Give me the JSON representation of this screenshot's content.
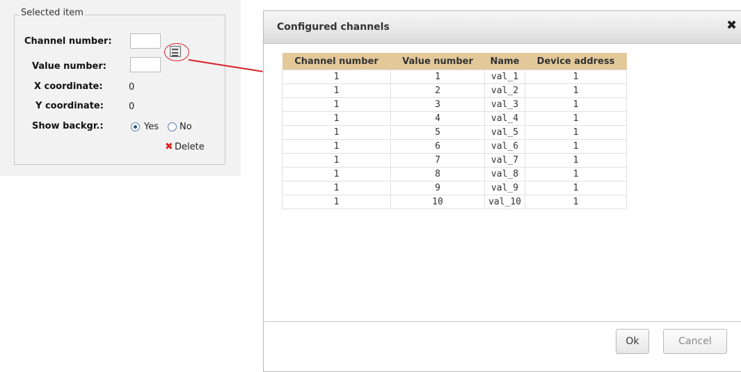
{
  "selected_item": {
    "legend": "Selected item",
    "channel_number_label": "Channel number:",
    "channel_number_value": "",
    "value_number_label": "Value number:",
    "value_number_value": "",
    "x_coordinate_label": "X coordinate:",
    "x_coordinate_value": "0",
    "y_coordinate_label": "Y coordinate:",
    "y_coordinate_value": "0",
    "show_background_label": "Show backgr.:",
    "radio_yes_label": "Yes",
    "radio_no_label": "No",
    "show_background_selected": "Yes",
    "delete_label": "Delete",
    "list_icon": "list-icon"
  },
  "annotation": {
    "color": "#d8202a"
  },
  "dialog": {
    "title": "Configured channels",
    "close_icon": "close-icon",
    "columns": [
      "Channel number",
      "Value number",
      "Name",
      "Device address"
    ],
    "rows": [
      [
        "1",
        "1",
        "val_1",
        "1"
      ],
      [
        "1",
        "2",
        "val_2",
        "1"
      ],
      [
        "1",
        "3",
        "val_3",
        "1"
      ],
      [
        "1",
        "4",
        "val_4",
        "1"
      ],
      [
        "1",
        "5",
        "val_5",
        "1"
      ],
      [
        "1",
        "6",
        "val_6",
        "1"
      ],
      [
        "1",
        "7",
        "val_7",
        "1"
      ],
      [
        "1",
        "8",
        "val_8",
        "1"
      ],
      [
        "1",
        "9",
        "val_9",
        "1"
      ],
      [
        "1",
        "10",
        "val_10",
        "1"
      ]
    ],
    "ok_label": "Ok",
    "cancel_label": "Cancel",
    "header_color": "#e3c89a"
  }
}
